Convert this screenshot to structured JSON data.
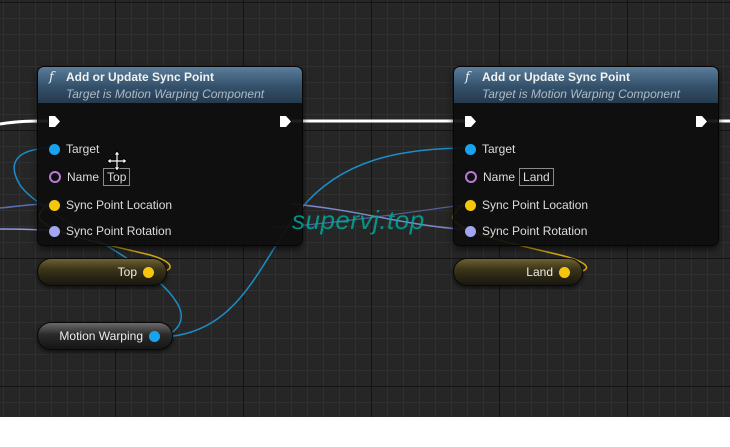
{
  "nodes": [
    {
      "title": "Add or Update Sync Point",
      "subtitle": "Target is Motion Warping Component",
      "func_icon": "f",
      "pins": {
        "target": "Target",
        "name": "Name",
        "name_value": "Top",
        "location": "Sync Point Location",
        "rotation": "Sync Point Rotation"
      }
    },
    {
      "title": "Add or Update Sync Point",
      "subtitle": "Target is Motion Warping Component",
      "func_icon": "f",
      "pins": {
        "target": "Target",
        "name": "Name",
        "name_value": "Land",
        "location": "Sync Point Location",
        "rotation": "Sync Point Rotation"
      }
    }
  ],
  "variables": {
    "top": "Top",
    "land": "Land",
    "motion_warping": "Motion Warping"
  },
  "watermark": "supervj.top",
  "colors": {
    "object_pin": "#19a3ee",
    "name_pin": "#b77ad6",
    "vector_pin": "#f6c60f",
    "rotator_pin": "#a0a7ee",
    "exec_wire": "#ffffff",
    "header": "#3f607c"
  }
}
